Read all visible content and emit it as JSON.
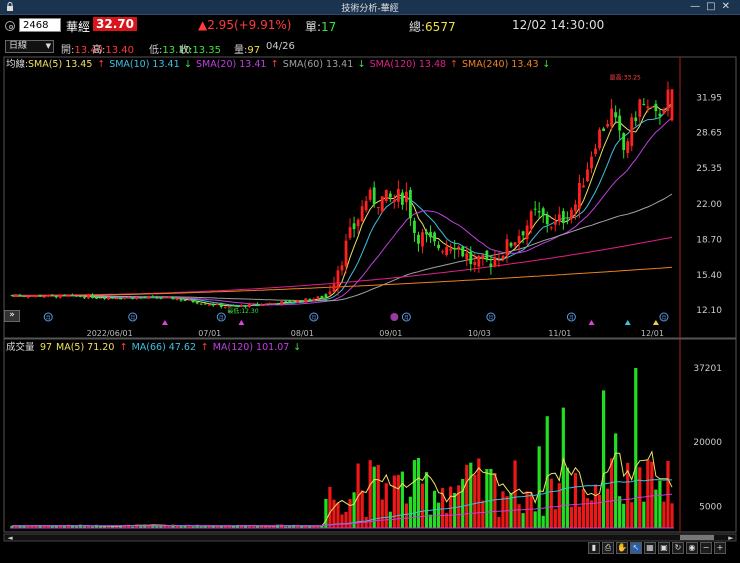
{
  "window": {
    "title": "技術分析-華經",
    "lock_icon": "lock-icon",
    "min_label": "—",
    "max_label": "□",
    "close_label": "✕"
  },
  "quote": {
    "code": "2468",
    "name": "華經",
    "price": "32.70",
    "change": "▲2.95(+9.91%)",
    "single_label": "單:",
    "single_value": "17",
    "total_label": "總:",
    "total_value": "6577",
    "datetime": "12/02 14:30:00"
  },
  "ohlc": {
    "period": "日線",
    "open_label": "開:",
    "open": "13.40",
    "high_label": "高:",
    "high": "13.40",
    "low_label": "低:",
    "low": "13.10",
    "close_label": "收:",
    "close": "13.35",
    "vol_label": "量:",
    "vol": "97",
    "date": "04/26"
  },
  "price_legend": {
    "prefix": "均線:",
    "items": [
      {
        "text": "SMA(5) 13.45",
        "arrow": "↑",
        "color": "#f0e060",
        "arrow_color": "#ff3b3b"
      },
      {
        "text": "SMA(10) 13.41",
        "arrow": "↓",
        "color": "#3ec0e0",
        "arrow_color": "#40e040"
      },
      {
        "text": "SMA(20) 13.41",
        "arrow": "↑",
        "color": "#c040e0",
        "arrow_color": "#ff3b3b"
      },
      {
        "text": "SMA(60) 13.41",
        "arrow": "↓",
        "color": "#a0a0a0",
        "arrow_color": "#40e040"
      },
      {
        "text": "SMA(120) 13.48",
        "arrow": "↑",
        "color": "#e0208a",
        "arrow_color": "#ff3b3b"
      },
      {
        "text": "SMA(240) 13.43",
        "arrow": "↓",
        "color": "#f08020",
        "arrow_color": "#40e040"
      }
    ]
  },
  "vol_legend": {
    "prefix": "成交量",
    "value": "97",
    "items": [
      {
        "text": "MA(5) 71.20",
        "arrow": "↑",
        "color": "#f0e060",
        "arrow_color": "#ff3b3b"
      },
      {
        "text": "MA(66) 47.62",
        "arrow": "↑",
        "color": "#3ec0e0",
        "arrow_color": "#ff3b3b"
      },
      {
        "text": "MA(120) 101.07",
        "arrow": "↓",
        "color": "#c040e0",
        "arrow_color": "#40e040"
      }
    ]
  },
  "chart_data": [
    {
      "type": "candlestick",
      "y_ticks": [
        31.95,
        28.65,
        25.35,
        22.0,
        18.7,
        15.4,
        12.1
      ],
      "y_tick_labels": [
        "31.95",
        "28.65",
        "25.35",
        "22.00",
        "18.70",
        "15.40",
        "12.10"
      ],
      "ylim": [
        11.0,
        34.5
      ],
      "x_date_labels": [
        "2022/06/01",
        "07/01",
        "08/01",
        "09/01",
        "10/03",
        "11/01",
        "12/01"
      ],
      "x_date_positions": [
        30,
        52,
        75,
        97,
        119,
        139,
        162
      ],
      "n_days": 165,
      "high_annotation": "最高:33.25",
      "low_annotation": "最低:12.30",
      "low_annotation_day": 54,
      "high_annotation_day": 150,
      "ohlc": [],
      "ma_colors": [
        "#f0e060",
        "#3ec0e0",
        "#c040e0",
        "#a0a0a0",
        "#e0208a",
        "#f08020"
      ],
      "ma_periods": [
        5,
        10,
        20,
        60,
        120,
        240
      ],
      "ma240_start": 13.4,
      "ma240_end": 16.1,
      "ma120_start": 13.5,
      "ma120_end": 18.9,
      "grid": false
    },
    {
      "type": "bar",
      "y_ticks": [
        37201,
        20000,
        5000
      ],
      "y_tick_labels": [
        "37201",
        "20000",
        "5000"
      ],
      "ylim": [
        0,
        40000
      ],
      "ma_colors": [
        "#f0e060",
        "#3ec0e0",
        "#c040e0"
      ],
      "ma_periods": [
        5,
        66,
        120
      ]
    }
  ],
  "markers": {
    "month_circle_label": "月",
    "circle_days": [
      9,
      30,
      52,
      75,
      98,
      119,
      139,
      162
    ],
    "flag_days": [
      96
    ],
    "up_triangle_days": [
      38,
      57,
      144,
      153
    ],
    "up_triangle_colors": [
      "#e040e0",
      "#e040e0",
      "#e040e0",
      "#40c0e0"
    ],
    "yellow_triangle_day": 160
  },
  "toolbar": {
    "scroll_left": "◄",
    "scroll_right": "►",
    "expand": "»",
    "tools": [
      {
        "name": "cursor-tool-icon",
        "glyph": "▮"
      },
      {
        "name": "print-icon",
        "glyph": "⎙"
      },
      {
        "name": "hand-icon",
        "glyph": "✋"
      },
      {
        "name": "pointer-icon",
        "glyph": "↖"
      },
      {
        "name": "grid-icon",
        "glyph": "▦"
      },
      {
        "name": "measure-icon",
        "glyph": "▣"
      },
      {
        "name": "refresh-icon",
        "glyph": "↻"
      },
      {
        "name": "eye-icon",
        "glyph": "◉"
      },
      {
        "name": "zoom-out-icon",
        "glyph": "−"
      },
      {
        "name": "zoom-in-icon",
        "glyph": "+"
      }
    ]
  }
}
